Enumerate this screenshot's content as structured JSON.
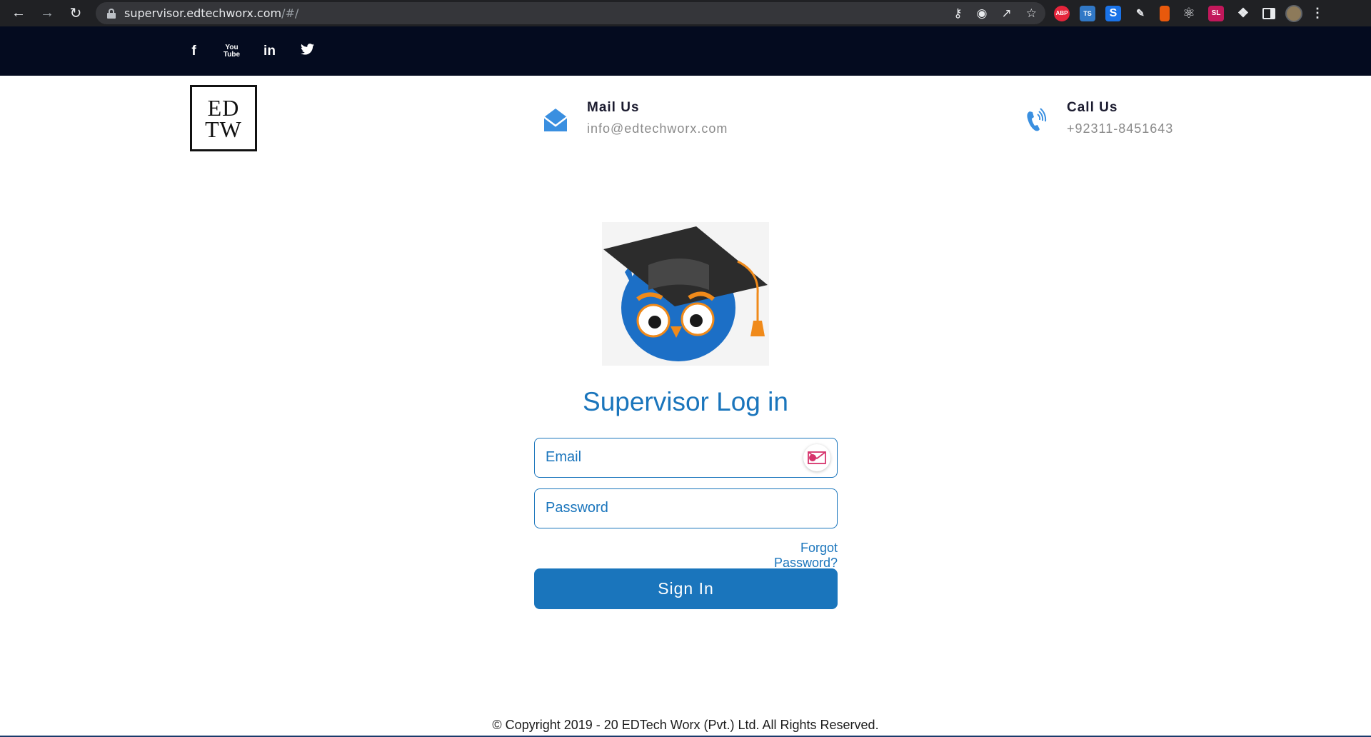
{
  "browser": {
    "url_host": "supervisor.edtechworx.com",
    "url_path": "/#/",
    "back_icon": "arrow-left-icon",
    "forward_icon": "arrow-right-icon",
    "reload_icon": "reload-icon",
    "extensions": [
      "ABP",
      "TS",
      "S",
      "SL"
    ]
  },
  "social": {
    "facebook": "f",
    "youtube": "You Tube",
    "linkedin": "in",
    "twitter": "🐦"
  },
  "header": {
    "logo_line1": "ED",
    "logo_line2": "TW",
    "mail_label": "Mail Us",
    "mail_value": "info@edtechworx.com",
    "call_label": "Call Us",
    "call_value": "+92311-8451643"
  },
  "login": {
    "title": "Supervisor Log in",
    "email_placeholder": "Email",
    "password_placeholder": "Password",
    "forgot_label": "Forgot Password?",
    "signin_label": "Sign In"
  },
  "footer": {
    "copyright": "© Copyright 2019 - 20 EDTech Worx (Pvt.) Ltd. All Rights Reserved."
  },
  "colors": {
    "primary": "#1a75bc",
    "topbar": "#040b1f",
    "chrome": "#202124"
  }
}
